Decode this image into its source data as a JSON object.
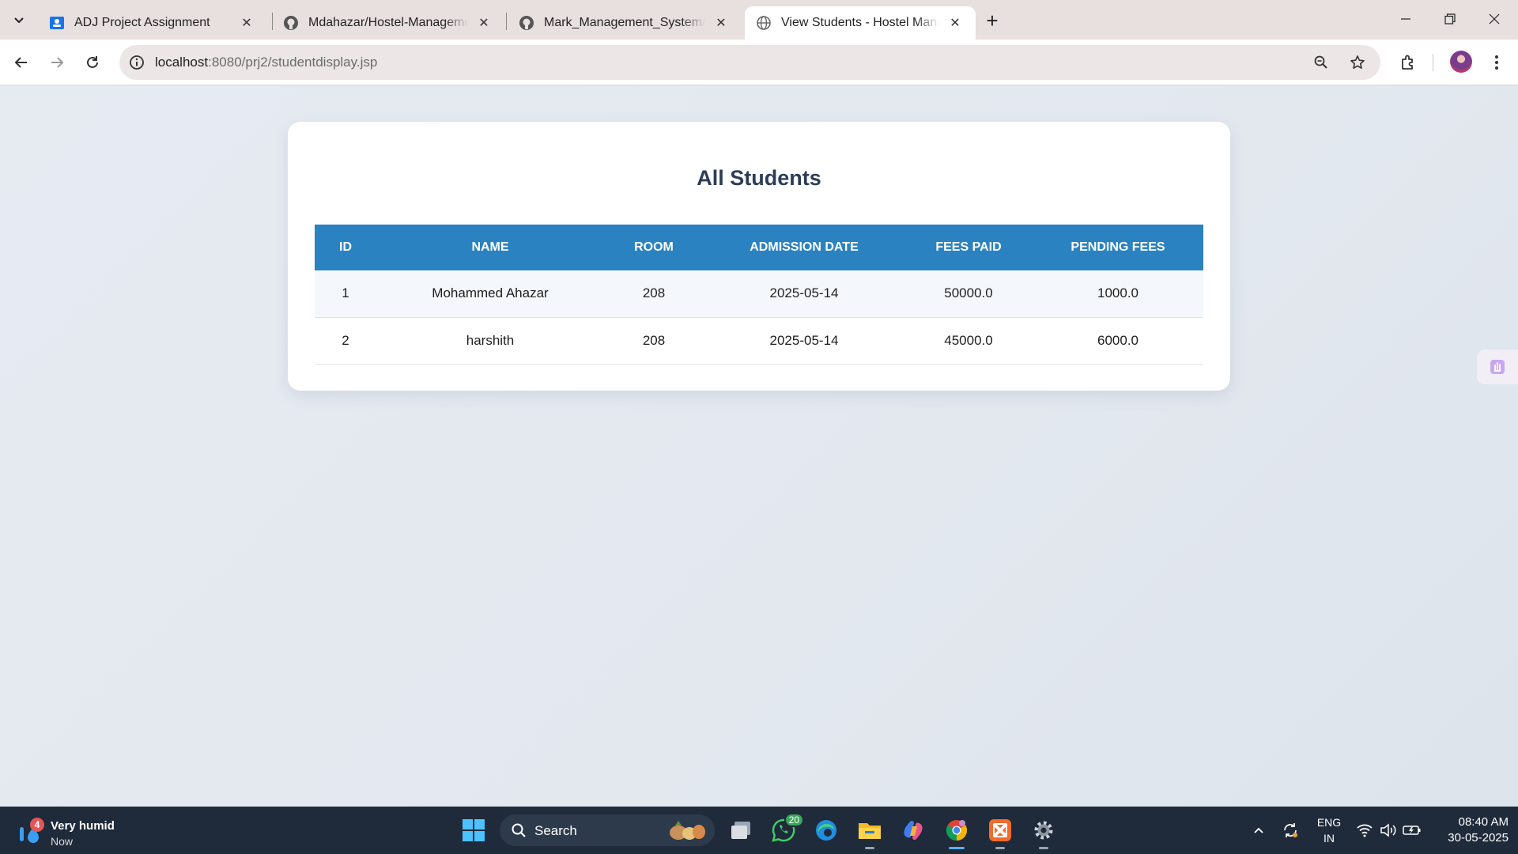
{
  "browser": {
    "tabs": [
      {
        "title": "ADJ Project Assignment",
        "icon": "classroom-icon"
      },
      {
        "title": "Mdahazar/Hostel-Management",
        "icon": "github-icon"
      },
      {
        "title": "Mark_Management_System/out",
        "icon": "github-icon"
      },
      {
        "title": "View Students - Hostel Management",
        "icon": "globe-icon"
      }
    ],
    "url_host": "localhost",
    "url_rest": ":8080/prj2/studentdisplay.jsp"
  },
  "page": {
    "title": "All Students",
    "table": {
      "headers": [
        "ID",
        "NAME",
        "ROOM",
        "ADMISSION DATE",
        "FEES PAID",
        "PENDING FEES"
      ],
      "rows": [
        [
          "1",
          "Mohammed Ahazar",
          "208",
          "2025-05-14",
          "50000.0",
          "1000.0"
        ],
        [
          "2",
          "harshith",
          "208",
          "2025-05-14",
          "45000.0",
          "6000.0"
        ]
      ]
    }
  },
  "taskbar": {
    "weather_badge": "4",
    "weather_title": "Very humid",
    "weather_sub": "Now",
    "search_label": "Search",
    "whatsapp_badge": "20",
    "lang_line1": "ENG",
    "lang_line2": "IN",
    "time": "08:40 AM",
    "date": "30-05-2025"
  },
  "colors": {
    "table_header": "#2b82c0",
    "title_text": "#2c3e56",
    "taskbar": "#1f2a3a"
  }
}
